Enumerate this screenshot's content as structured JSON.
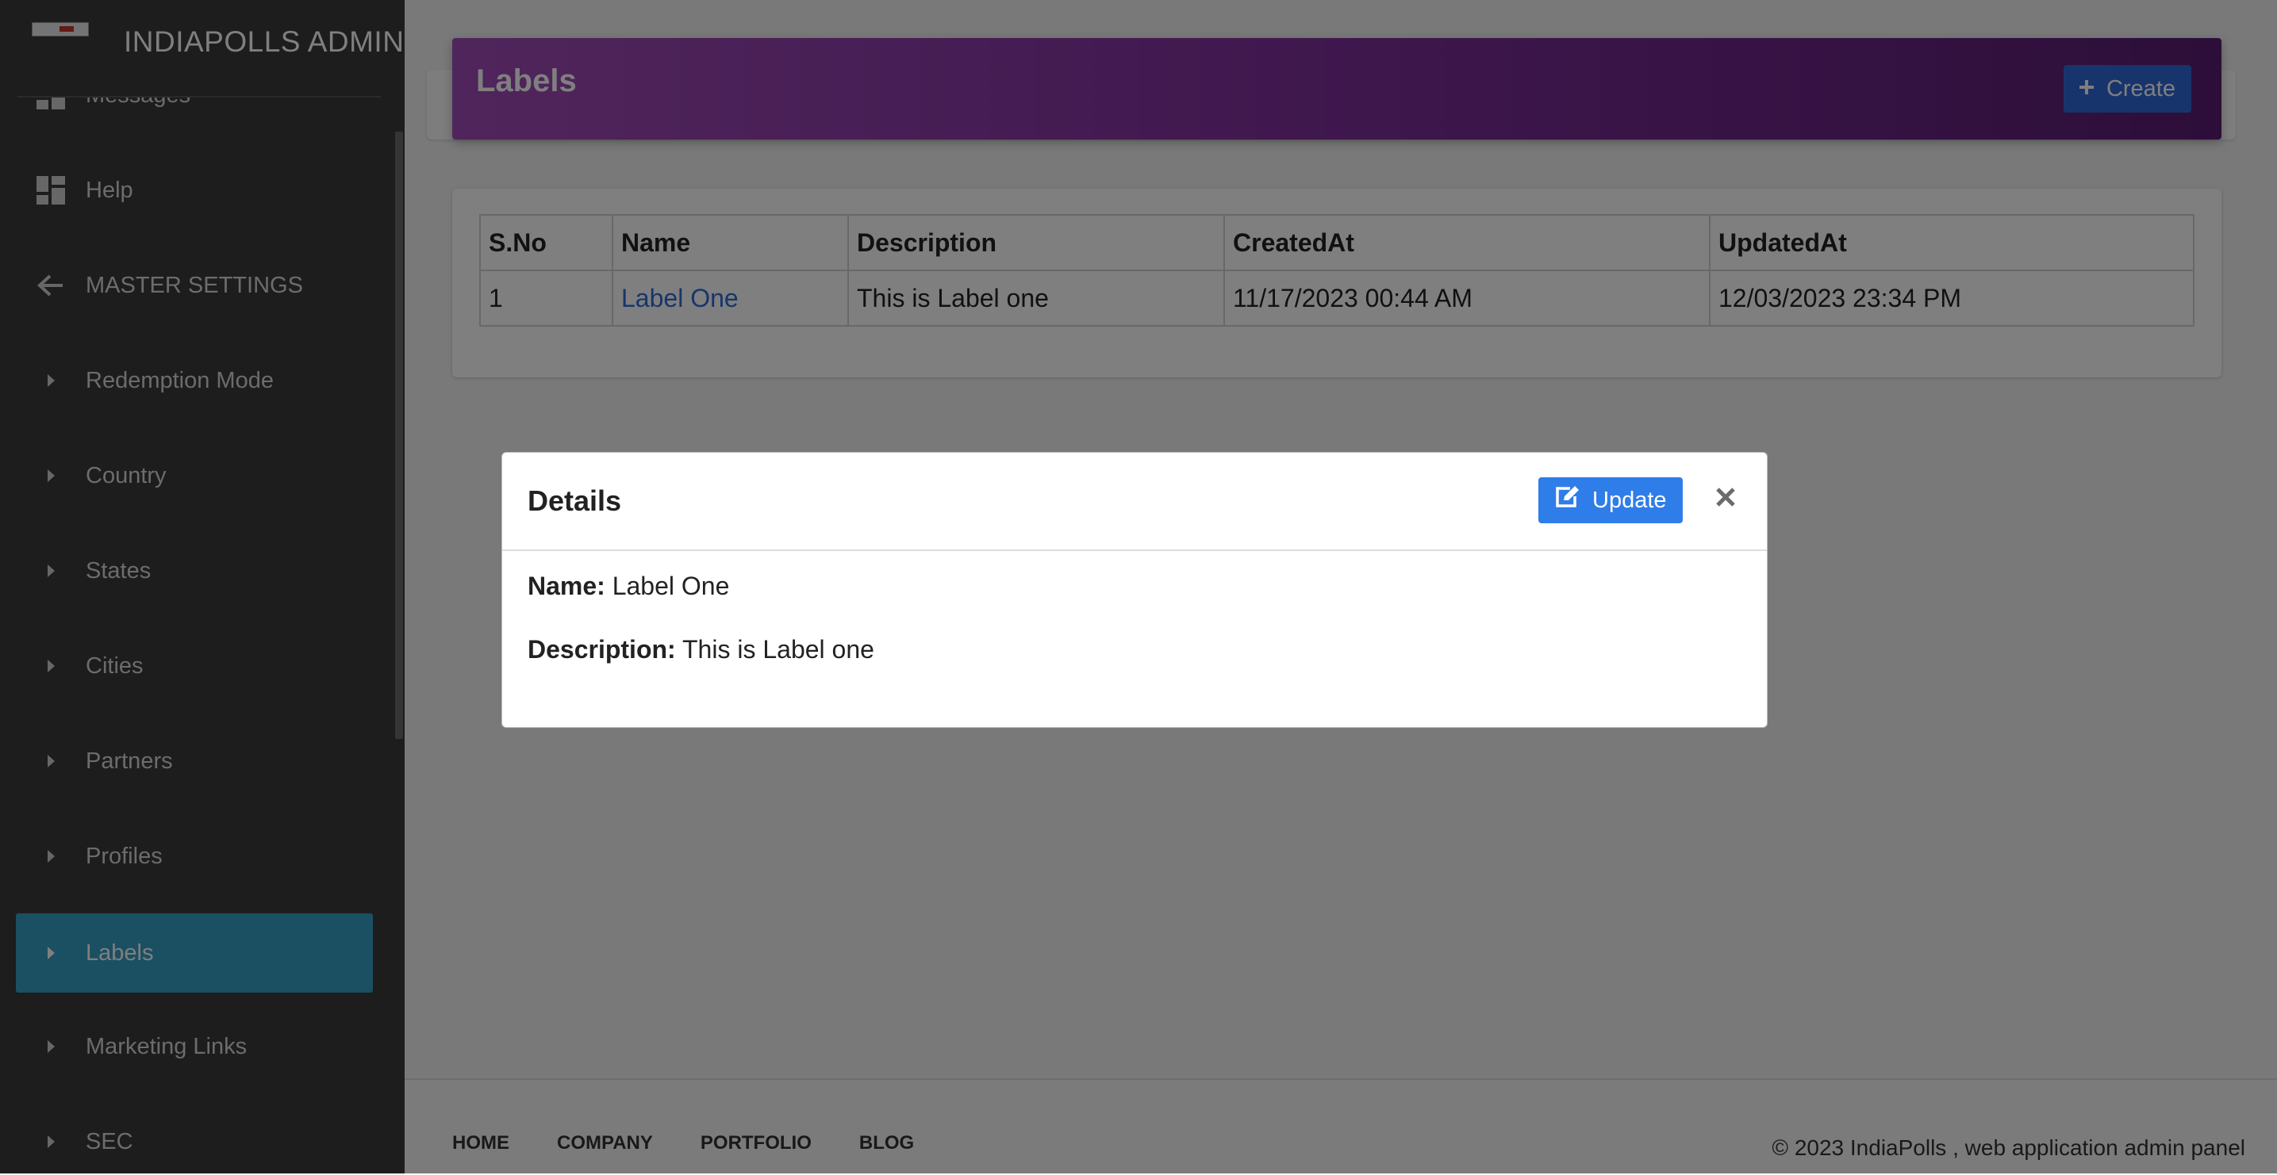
{
  "brand": {
    "title": "INDIAPOLLS ADMIN"
  },
  "sidebar": {
    "items": [
      {
        "label": "Messages",
        "icon": "dashboard-icon"
      },
      {
        "label": "Help",
        "icon": "dashboard-icon"
      },
      {
        "label": "MASTER SETTINGS",
        "icon": "arrow-left-icon"
      },
      {
        "label": "Redemption Mode",
        "icon": "caret-right-icon"
      },
      {
        "label": "Country",
        "icon": "caret-right-icon"
      },
      {
        "label": "States",
        "icon": "caret-right-icon"
      },
      {
        "label": "Cities",
        "icon": "caret-right-icon"
      },
      {
        "label": "Partners",
        "icon": "caret-right-icon"
      },
      {
        "label": "Profiles",
        "icon": "caret-right-icon"
      },
      {
        "label": "Labels",
        "icon": "caret-right-icon",
        "active": true
      },
      {
        "label": "Marketing Links",
        "icon": "caret-right-icon"
      },
      {
        "label": "SEC",
        "icon": "caret-right-icon"
      }
    ]
  },
  "header": {
    "title": "Labels",
    "create_label": "Create"
  },
  "table": {
    "columns": [
      "S.No",
      "Name",
      "Description",
      "CreatedAt",
      "UpdatedAt"
    ],
    "rows": [
      [
        "1",
        "Label One",
        "This is Label one",
        "11/17/2023 00:44 AM",
        "12/03/2023 23:34 PM"
      ]
    ]
  },
  "modal": {
    "title": "Details",
    "update_label": "Update",
    "name_label": "Name:",
    "name_value": "Label One",
    "description_label": "Description:",
    "description_value": "This is Label one"
  },
  "footer": {
    "links": [
      "HOME",
      "COMPANY",
      "PORTFOLIO",
      "BLOG"
    ],
    "copyright": "© 2023 IndiaPolls , web application admin panel"
  },
  "colors": {
    "sidebar_bg": "#3a3a3a",
    "active_item": "#35a1c4",
    "header_gradient_start": "#a04bb9",
    "header_gradient_end": "#5a1d73",
    "primary_button": "#2f6bd8",
    "link": "#2f6bd8"
  }
}
